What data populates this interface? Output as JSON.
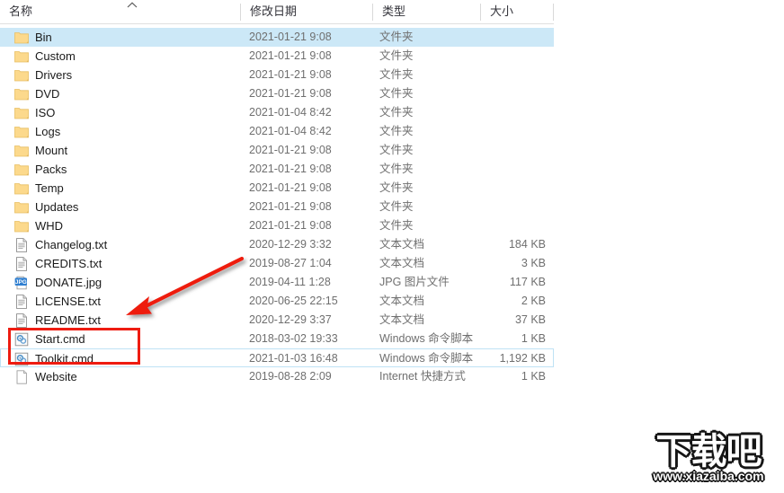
{
  "columns": {
    "name": "名称",
    "date_modified": "修改日期",
    "type": "类型",
    "size": "大小",
    "sort_indicator": "chevron-up-icon"
  },
  "files": [
    {
      "name": "Bin",
      "date": "2021-01-21 9:08",
      "type": "文件夹",
      "size": "",
      "icon": "folder",
      "state": "selected"
    },
    {
      "name": "Custom",
      "date": "2021-01-21 9:08",
      "type": "文件夹",
      "size": "",
      "icon": "folder",
      "state": "normal"
    },
    {
      "name": "Drivers",
      "date": "2021-01-21 9:08",
      "type": "文件夹",
      "size": "",
      "icon": "folder",
      "state": "normal"
    },
    {
      "name": "DVD",
      "date": "2021-01-21 9:08",
      "type": "文件夹",
      "size": "",
      "icon": "folder",
      "state": "normal"
    },
    {
      "name": "ISO",
      "date": "2021-01-04 8:42",
      "type": "文件夹",
      "size": "",
      "icon": "folder",
      "state": "normal"
    },
    {
      "name": "Logs",
      "date": "2021-01-04 8:42",
      "type": "文件夹",
      "size": "",
      "icon": "folder",
      "state": "normal"
    },
    {
      "name": "Mount",
      "date": "2021-01-21 9:08",
      "type": "文件夹",
      "size": "",
      "icon": "folder",
      "state": "normal"
    },
    {
      "name": "Packs",
      "date": "2021-01-21 9:08",
      "type": "文件夹",
      "size": "",
      "icon": "folder",
      "state": "normal"
    },
    {
      "name": "Temp",
      "date": "2021-01-21 9:08",
      "type": "文件夹",
      "size": "",
      "icon": "folder",
      "state": "normal"
    },
    {
      "name": "Updates",
      "date": "2021-01-21 9:08",
      "type": "文件夹",
      "size": "",
      "icon": "folder",
      "state": "normal"
    },
    {
      "name": "WHD",
      "date": "2021-01-21 9:08",
      "type": "文件夹",
      "size": "",
      "icon": "folder",
      "state": "normal"
    },
    {
      "name": "Changelog.txt",
      "date": "2020-12-29 3:32",
      "type": "文本文档",
      "size": "184 KB",
      "icon": "text-document",
      "state": "normal"
    },
    {
      "name": "CREDITS.txt",
      "date": "2019-08-27 1:04",
      "type": "文本文档",
      "size": "3 KB",
      "icon": "text-document",
      "state": "normal"
    },
    {
      "name": "DONATE.jpg",
      "date": "2019-04-11 1:28",
      "type": "JPG 图片文件",
      "size": "117 KB",
      "icon": "jpg-image",
      "state": "normal"
    },
    {
      "name": "LICENSE.txt",
      "date": "2020-06-25 22:15",
      "type": "文本文档",
      "size": "2 KB",
      "icon": "text-document",
      "state": "normal"
    },
    {
      "name": "README.txt",
      "date": "2020-12-29 3:37",
      "type": "文本文档",
      "size": "37 KB",
      "icon": "text-document",
      "state": "normal"
    },
    {
      "name": "Start.cmd",
      "date": "2018-03-02 19:33",
      "type": "Windows 命令脚本",
      "size": "1 KB",
      "icon": "cmd-script",
      "state": "normal"
    },
    {
      "name": "Toolkit.cmd",
      "date": "2021-01-03 16:48",
      "type": "Windows 命令脚本",
      "size": "1,192 KB",
      "icon": "cmd-script",
      "state": "hovered"
    },
    {
      "name": "Website",
      "date": "2019-08-28 2:09",
      "type": "Internet 快捷方式",
      "size": "1 KB",
      "icon": "internet-shortcut",
      "state": "normal"
    }
  ],
  "annotations": {
    "highlight_color": "#ee1c11",
    "highlight_box_label": "red-rectangle-around-start-and-toolkit",
    "arrow_label": "red-arrow-pointing-to-highlight"
  },
  "watermark": {
    "brand": "下载吧",
    "url": "www.xiazaiba.com"
  },
  "colors": {
    "selection": "#cce8f7",
    "hover_border": "#bfe2f5",
    "folder": "#fdd97a",
    "annotation_red": "#ee1c11"
  }
}
